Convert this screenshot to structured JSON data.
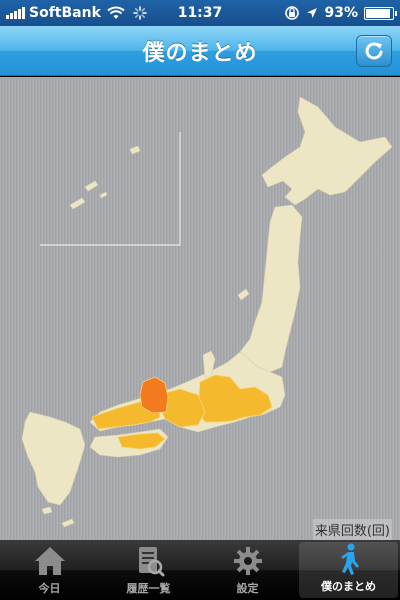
{
  "status_bar": {
    "carrier": "SoftBank",
    "time": "11:37",
    "battery_percent": "93%",
    "battery_level": 0.93
  },
  "nav": {
    "title": "僕のまとめ"
  },
  "map": {
    "legend_label": "来県回数(回)",
    "colors": {
      "land": "#ece6c5",
      "visited_low": "#f5b92e",
      "visited_high": "#f27a1f",
      "ocean": "#a9aaae"
    }
  },
  "tabs": [
    {
      "label": "今日",
      "icon": "home-icon",
      "active": false
    },
    {
      "label": "履歴一覧",
      "icon": "history-list-icon",
      "active": false
    },
    {
      "label": "設定",
      "icon": "gear-icon",
      "active": false
    },
    {
      "label": "僕のまとめ",
      "icon": "walking-person-icon",
      "active": true
    }
  ]
}
